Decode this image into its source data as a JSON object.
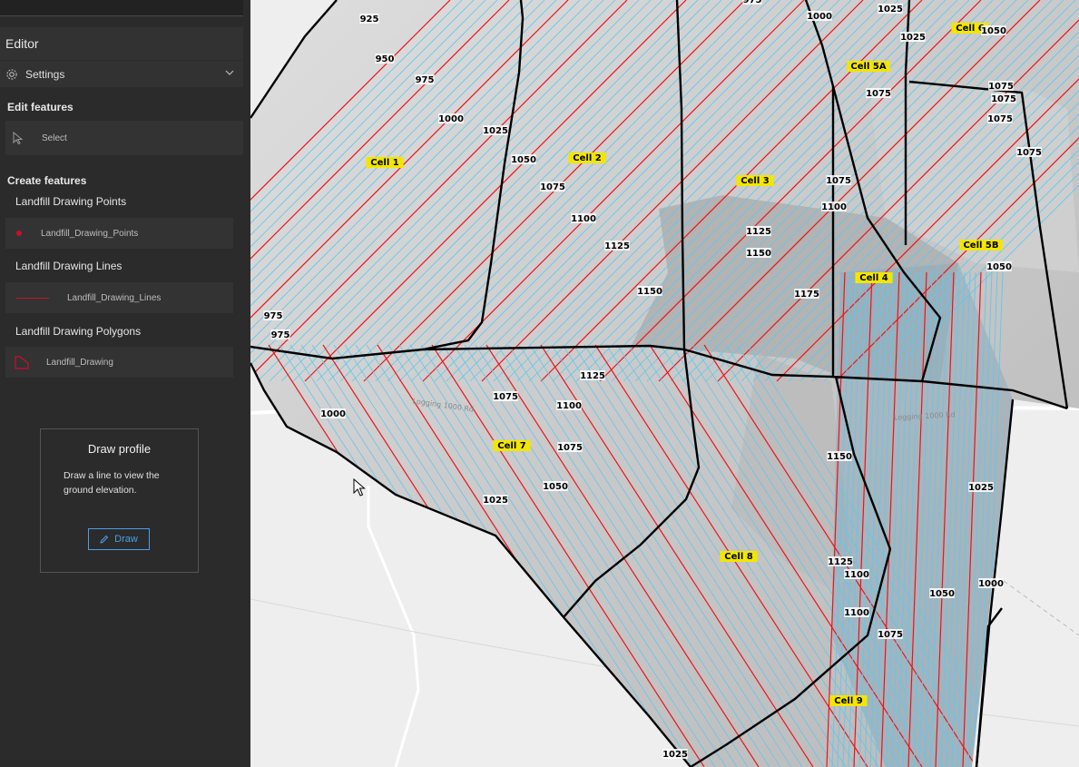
{
  "editor": {
    "title": "Editor",
    "settings_label": "Settings",
    "edit_features_heading": "Edit features",
    "select_label": "Select",
    "create_features_heading": "Create features",
    "layers": [
      {
        "title": "Landfill Drawing Points",
        "template": "Landfill_Drawing_Points"
      },
      {
        "title": "Landfill Drawing Lines",
        "template": "Landfill_Drawing_Lines"
      },
      {
        "title": "Landfill Drawing Polygons",
        "template": "Landfill_Drawing"
      }
    ]
  },
  "profile": {
    "title": "Draw profile",
    "description": "Draw a line to view the ground elevation.",
    "draw_label": "Draw"
  },
  "map": {
    "cell_labels": [
      "Cell 1",
      "Cell 2",
      "Cell 3",
      "Cell 4",
      "Cell 5A",
      "Cell 5B",
      "Cell 6",
      "Cell 7",
      "Cell 8",
      "Cell 9"
    ],
    "contour_labels": [
      "925",
      "950",
      "975",
      "1000",
      "1025",
      "1050",
      "1075",
      "1100",
      "1125",
      "1150",
      "1175",
      "975",
      "975",
      "1000",
      "1075",
      "1100",
      "1075",
      "1050",
      "1025",
      "1125",
      "1150",
      "1125",
      "1125",
      "1100",
      "1100",
      "1050",
      "1075",
      "1025",
      "1000",
      "1025",
      "1150",
      "1075",
      "1100",
      "1075",
      "1075",
      "1075",
      "1075",
      "1050",
      "1000",
      "1025",
      "1050",
      "1075",
      "1025",
      "975"
    ],
    "road_labels": [
      "Logging 1000 Rd",
      "Logging 1000 Rd"
    ],
    "colors": {
      "major_contour": "#e8141e",
      "minor_contour": "#5ec8ee",
      "boundary": "#000000",
      "cell_label_bg": "#f2e600"
    }
  }
}
